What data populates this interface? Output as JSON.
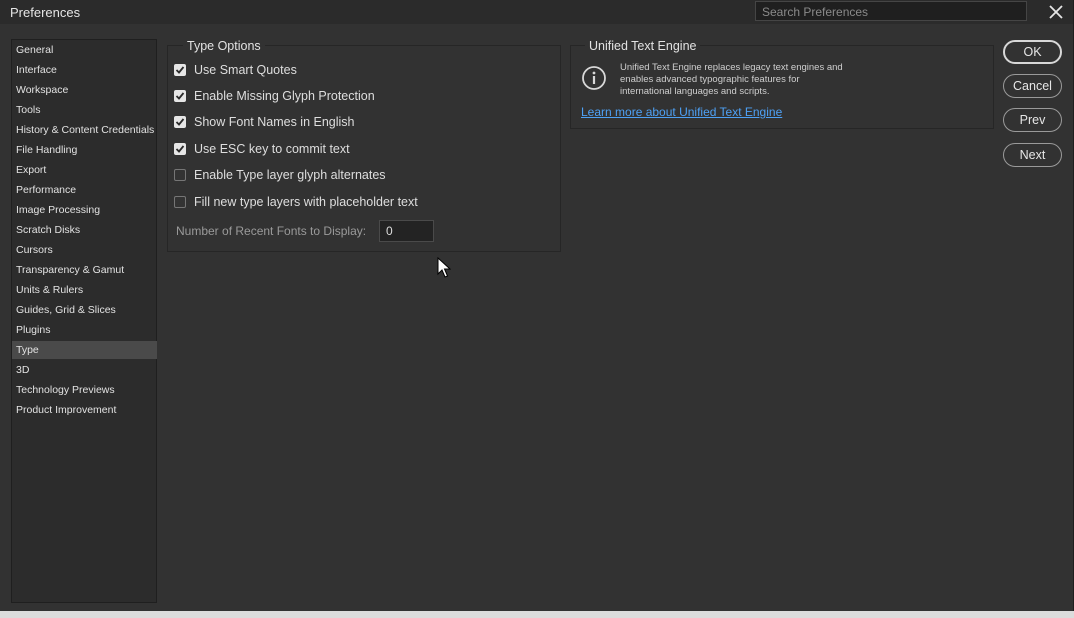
{
  "window": {
    "title": "Preferences",
    "search_placeholder": "Search Preferences"
  },
  "sidebar": {
    "selected": "Type",
    "items": [
      {
        "label": "General"
      },
      {
        "label": "Interface"
      },
      {
        "label": "Workspace"
      },
      {
        "label": "Tools"
      },
      {
        "label": "History & Content Credentials"
      },
      {
        "label": "File Handling"
      },
      {
        "label": "Export"
      },
      {
        "label": "Performance"
      },
      {
        "label": "Image Processing"
      },
      {
        "label": "Scratch Disks"
      },
      {
        "label": "Cursors"
      },
      {
        "label": "Transparency & Gamut"
      },
      {
        "label": "Units & Rulers"
      },
      {
        "label": "Guides, Grid & Slices"
      },
      {
        "label": "Plugins"
      },
      {
        "label": "Type"
      },
      {
        "label": "3D"
      },
      {
        "label": "Technology Previews"
      },
      {
        "label": "Product Improvement"
      }
    ]
  },
  "type_options": {
    "title": "Type Options",
    "checkboxes": [
      {
        "label": "Use Smart Quotes",
        "checked": true
      },
      {
        "label": "Enable Missing Glyph Protection",
        "checked": true
      },
      {
        "label": "Show Font Names in English",
        "checked": true
      },
      {
        "label": "Use ESC key to commit text",
        "checked": true
      },
      {
        "label": "Enable Type layer glyph alternates",
        "checked": false
      },
      {
        "label": "Fill new type layers with placeholder text",
        "checked": false
      }
    ],
    "recent_fonts_label": "Number of Recent Fonts to Display:",
    "recent_fonts_value": "0"
  },
  "unified_text_engine": {
    "title": "Unified Text Engine",
    "icon": "info-icon",
    "description_lines": [
      "Unified Text Engine replaces legacy text engines and",
      "enables advanced typographic features for",
      "international languages and scripts."
    ],
    "link": "Learn more about Unified Text Engine"
  },
  "buttons": {
    "ok": "OK",
    "cancel": "Cancel",
    "prev": "Prev",
    "next": "Next"
  },
  "colors": {
    "window_bg": "#323232",
    "link": "#4ea1f5",
    "selected_item": "#4a4a4a"
  }
}
